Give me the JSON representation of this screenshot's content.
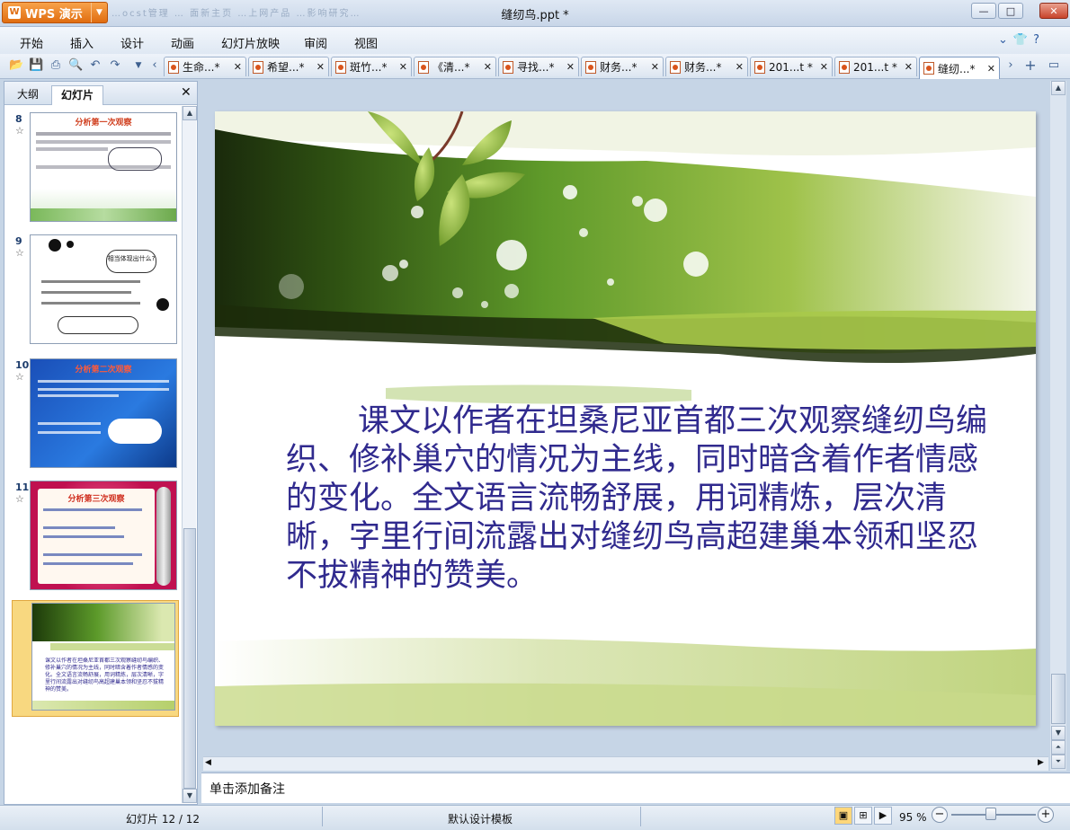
{
  "app": {
    "name": "WPS 演示",
    "document_title": "缝纫鸟.ppt *"
  },
  "background_tabs": "…ocst管理 … 面新主页 …上网产品 …影响研究…",
  "window_buttons": {
    "minimize": "—",
    "maximize": "□",
    "close": "✕"
  },
  "menu": [
    "开始",
    "插入",
    "设计",
    "动画",
    "幻灯片放映",
    "审阅",
    "视图"
  ],
  "menu_right": {
    "collapse": "⌄",
    "skin": "👕",
    "help": "?"
  },
  "toolbar_icons": [
    "open-icon",
    "save-icon",
    "print-icon",
    "print-preview-icon",
    "undo-icon",
    "redo-icon",
    "dropdown-icon"
  ],
  "doc_tabs": [
    {
      "label": "生命...*",
      "active": false
    },
    {
      "label": "希望...*",
      "active": false
    },
    {
      "label": "斑竹...*",
      "active": false
    },
    {
      "label": "《清...*",
      "active": false
    },
    {
      "label": "寻找...*",
      "active": false
    },
    {
      "label": "财务...*",
      "active": false
    },
    {
      "label": "财务...*",
      "active": false
    },
    {
      "label": "201...t *",
      "active": false
    },
    {
      "label": "201...t *",
      "active": false
    },
    {
      "label": "缝纫...*",
      "active": true
    }
  ],
  "tab_close": "✕",
  "left_pane": {
    "tabs": [
      "大纲",
      "幻灯片"
    ],
    "active_tab": "幻灯片",
    "close": "✕",
    "slides": [
      {
        "number": "8",
        "title": "分析第一次观察"
      },
      {
        "number": "9",
        "title": "相当体现出什么?"
      },
      {
        "number": "10",
        "title": "分析第二次观察"
      },
      {
        "number": "11",
        "title": "分析第三次观察"
      },
      {
        "number": "12",
        "title": ""
      }
    ],
    "star": "☆"
  },
  "slide": {
    "text": "课文以作者在坦桑尼亚首都三次观察缝纫鸟编织、修补巢穴的情况为主线，同时暗含着作者情感的变化。全文语言流畅舒展，用词精炼，层次清晰，字里行间流露出对缝纫鸟高超建巢本领和坚忍不拔精神的赞美。"
  },
  "notes": {
    "placeholder": "单击添加备注"
  },
  "status": {
    "slide_position": "幻灯片 12 / 12",
    "template": "默认设计模板",
    "zoom": "95 %",
    "zoom_level": 0.95
  },
  "colors": {
    "slide_text": "#302a8e",
    "accent": "#e06d10",
    "leaf_green": "#5f9a2a"
  }
}
